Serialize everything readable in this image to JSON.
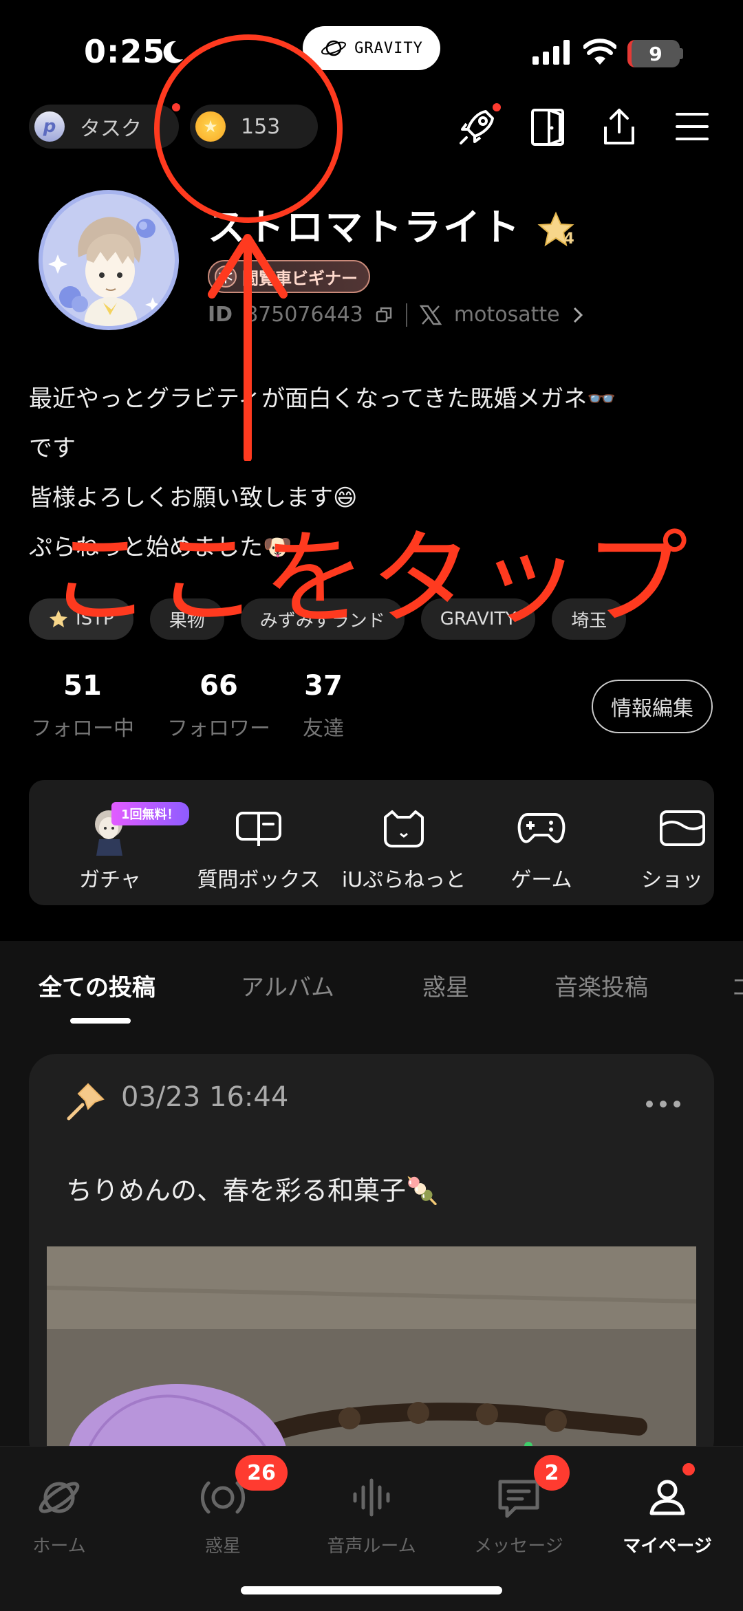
{
  "status_bar": {
    "time": "0:25",
    "battery": "9"
  },
  "app_pill": {
    "label": "GRAVITY"
  },
  "top_chips": {
    "task_label": "タスク",
    "coin_count": "153"
  },
  "profile": {
    "name": "ストロマトライト",
    "star_level": "4",
    "badge": "閲覧車ビギナー",
    "id_prefix": "ID",
    "id_value": "875076443",
    "x_handle": "motosatte",
    "bio_lines": [
      "最近やっとグラビティが面白くなってきた既婚メガネ👓",
      "です",
      "皆様よろしくお願い致します😄",
      "ぷらねっと始めました🐶"
    ],
    "tags": [
      "ISTP",
      "果物",
      "みずみずランド",
      "GRAVITY",
      "埼玉"
    ],
    "stats": [
      {
        "num": "51",
        "label": "フォロー中"
      },
      {
        "num": "66",
        "label": "フォロワー"
      },
      {
        "num": "37",
        "label": "友達"
      }
    ],
    "edit_button": "情報編集"
  },
  "features": [
    {
      "label": "ガチャ",
      "badge": "1回無料！"
    },
    {
      "label": "質問ボックス"
    },
    {
      "label": "iUぷらねっと"
    },
    {
      "label": "ゲーム"
    },
    {
      "label": "ショッ"
    }
  ],
  "tabs": [
    "全ての投稿",
    "アルバム",
    "惑星",
    "音楽投稿",
    "コ"
  ],
  "post": {
    "date": "03/23 16:44",
    "text": "ちりめんの、春を彩る和菓子🍡"
  },
  "overlay": {
    "instruction": "ここをタップ"
  },
  "bottom_nav": [
    {
      "label": "ホーム"
    },
    {
      "label": "惑星",
      "badge": "26"
    },
    {
      "label": "音声ルーム"
    },
    {
      "label": "メッセージ",
      "badge": "2"
    },
    {
      "label": "マイページ"
    }
  ]
}
